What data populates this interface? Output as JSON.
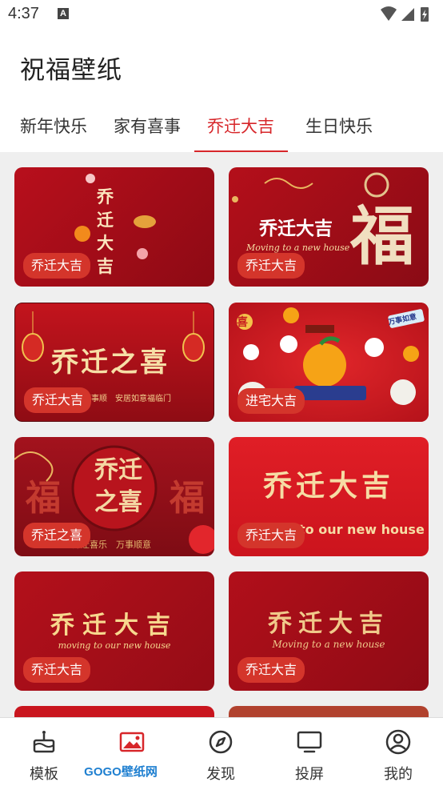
{
  "status_bar": {
    "time": "4:37",
    "notification_glyph": "A"
  },
  "app_title": "祝福壁纸",
  "tabs": [
    {
      "label": "新年快乐",
      "active": false
    },
    {
      "label": "家有喜事",
      "active": false
    },
    {
      "label": "乔迁大吉",
      "active": true
    },
    {
      "label": "生日快乐",
      "active": false
    }
  ],
  "cards": [
    {
      "badge": "乔迁大吉",
      "art": "乔迁大吉"
    },
    {
      "badge": "乔迁大吉",
      "art": "乔迁大吉",
      "art_big": "福",
      "art_sub": "Moving to a new house"
    },
    {
      "badge": "乔迁大吉",
      "art": "乔迁之喜",
      "art_sub": "万事顺　安居如意福临门"
    },
    {
      "badge": "进宅大吉",
      "art": "喜",
      "art_sub": "万事如意"
    },
    {
      "badge": "乔迁之喜",
      "art": "乔迁之喜",
      "art_big": "福",
      "art_sub": "乔迁喜乐　万事顺意"
    },
    {
      "badge": "乔迁大吉",
      "art": "乔迁大吉",
      "art_sub": "to our new house"
    },
    {
      "badge": "乔迁大吉",
      "art": "乔迁大吉",
      "art_sub": "moving to our new house"
    },
    {
      "badge": "乔迁大吉",
      "art": "乔迁大吉",
      "art_sub": "Moving to a new house"
    }
  ],
  "bottom_nav": [
    {
      "label": "模板",
      "icon": "cake-icon",
      "active": false
    },
    {
      "label": "壁纸",
      "icon": "image-icon",
      "active": true
    },
    {
      "label": "发现",
      "icon": "compass-icon",
      "active": false
    },
    {
      "label": "投屏",
      "icon": "tv-icon",
      "active": false
    },
    {
      "label": "我的",
      "icon": "user-icon",
      "active": false
    }
  ],
  "watermark": "GOGO壁纸网",
  "colors": {
    "accent": "#d7262a",
    "card_red": "#b3101b",
    "gold": "#f7dda2"
  }
}
